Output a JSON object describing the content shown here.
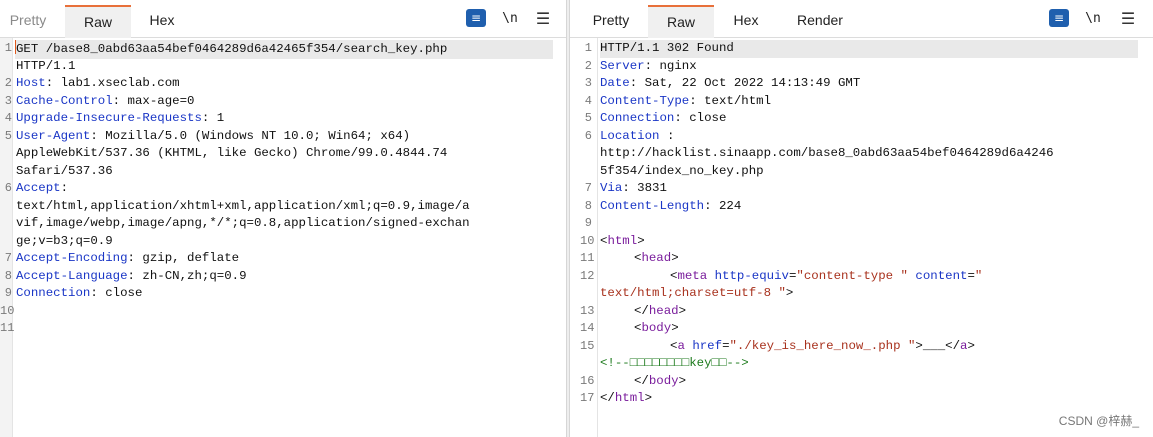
{
  "left_pane": {
    "tabs": [
      {
        "label": "Pretty",
        "active": false
      },
      {
        "label": "Raw",
        "active": true
      },
      {
        "label": "Hex",
        "active": false
      }
    ],
    "toolbar": {
      "newline_label": "\\n",
      "wrap_icon": "wrap-icon",
      "menu_icon": "hamburger-menu-icon"
    },
    "line_numbers": [
      "1",
      "2",
      "3",
      "4",
      "5",
      "6",
      "7",
      "8",
      "9",
      "10",
      "11"
    ],
    "lines": [
      "GET /base8_0abd63aa54bef0464289d6a42465f354/search_key.php",
      "HTTP/1.1",
      "Host: lab1.xseclab.com",
      "Cache-Control: max-age=0",
      "Upgrade-Insecure-Requests: 1",
      "User-Agent: Mozilla/5.0 (Windows NT 10.0; Win64; x64)",
      "AppleWebKit/537.36 (KHTML, like Gecko) Chrome/99.0.4844.74",
      "Safari/537.36",
      "Accept:",
      "text/html,application/xhtml+xml,application/xml;q=0.9,image/a",
      "vif,image/webp,image/apng,*/*;q=0.8,application/signed-exchan",
      "ge;v=b3;q=0.9",
      "Accept-Encoding: gzip, deflate",
      "Accept-Language: zh-CN,zh;q=0.9",
      "Connection: close"
    ]
  },
  "right_pane": {
    "tabs": [
      {
        "label": "Pretty",
        "active": false
      },
      {
        "label": "Raw",
        "active": true
      },
      {
        "label": "Hex",
        "active": false
      },
      {
        "label": "Render",
        "active": false
      }
    ],
    "toolbar": {
      "newline_label": "\\n",
      "wrap_icon": "wrap-icon",
      "menu_icon": "hamburger-menu-icon"
    },
    "line_numbers": [
      "1",
      "2",
      "3",
      "4",
      "5",
      "6",
      "7",
      "8",
      "9",
      "10",
      "11",
      "12",
      "13",
      "14",
      "15",
      "16",
      "17"
    ],
    "lines": {
      "status": "HTTP/1.1 302 Found",
      "server_key": "Server",
      "server_val": ": nginx",
      "date_key": "Date",
      "date_val": ": Sat, 22 Oct 2022 14:13:49 GMT",
      "ctype_key": "Content-Type",
      "ctype_val": ": text/html",
      "conn_key": "Connection",
      "conn_val": ": close",
      "loc_key": "Location",
      "loc_sep": ":",
      "loc_url_1": "http://hacklist.sinaapp.com/base8_0abd63aa54bef0464289d6a4246",
      "loc_url_2": "5f354/index_no_key.php",
      "via_key": "Via",
      "via_val": ": 3831",
      "clen_key": "Content-Length",
      "clen_val": ": 224",
      "html_open": "html",
      "head_open": "head",
      "meta_tag": "meta",
      "meta_attr1": "http-equiv",
      "meta_val1": "\"content-type \"",
      "meta_attr2": "content",
      "meta_val2a": "\"",
      "meta_val2b": "text/html;charset=utf-8 \"",
      "head_close": "head",
      "body_open": "body",
      "a_tag": "a",
      "a_attr": "href",
      "a_val": "\"./key_is_here_now_.php \"",
      "a_text": "___",
      "a_close": "a",
      "comment": "<!--□□□□□□□□key□□-->",
      "body_close": "body",
      "html_close": "html"
    }
  },
  "watermark": "CSDN @梓赫_"
}
